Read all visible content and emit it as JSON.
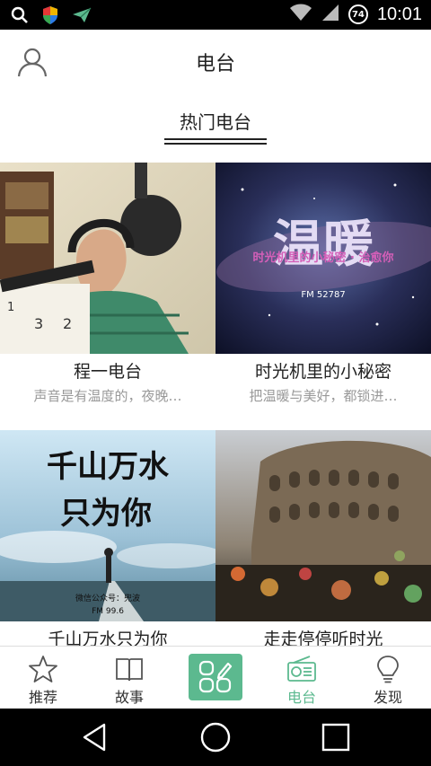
{
  "status_bar": {
    "time": "10:01",
    "battery_level": "74",
    "left_icons": [
      "search-icon",
      "shield-icon",
      "paperplane-icon"
    ],
    "right_icons": [
      "wifi-icon",
      "signal-icon",
      "battery-icon"
    ]
  },
  "header": {
    "title": "电台",
    "user_icon": "user-icon"
  },
  "section": {
    "label": "热门电台"
  },
  "stations": [
    {
      "name": "程一电台",
      "desc": "声音是有温度的，夜晚…"
    },
    {
      "name": "时光机里的小秘密",
      "desc": "把温暖与美好，都锁进…",
      "cover_text": "时光机里的小秘密 · 治愈你",
      "cover_big": "温暖",
      "cover_fm": "FM  52787"
    },
    {
      "name": "千山万水只为你",
      "desc": "",
      "cover_line1": "千山万水",
      "cover_line2": "只为你",
      "cover_sub": "微信公众号：兜波",
      "cover_fm": "FM 99.6"
    },
    {
      "name": "走走停停听时光",
      "desc": ""
    }
  ],
  "nav": {
    "items": [
      {
        "label": "推荐",
        "icon": "star-icon"
      },
      {
        "label": "故事",
        "icon": "book-icon"
      },
      {
        "label": "",
        "icon": "grid-pencil-icon"
      },
      {
        "label": "电台",
        "icon": "radio-icon"
      },
      {
        "label": "发现",
        "icon": "bulb-icon"
      }
    ],
    "active_index": 3
  },
  "colors": {
    "accent": "#5cb98f",
    "text": "#222222",
    "muted": "#999999"
  }
}
